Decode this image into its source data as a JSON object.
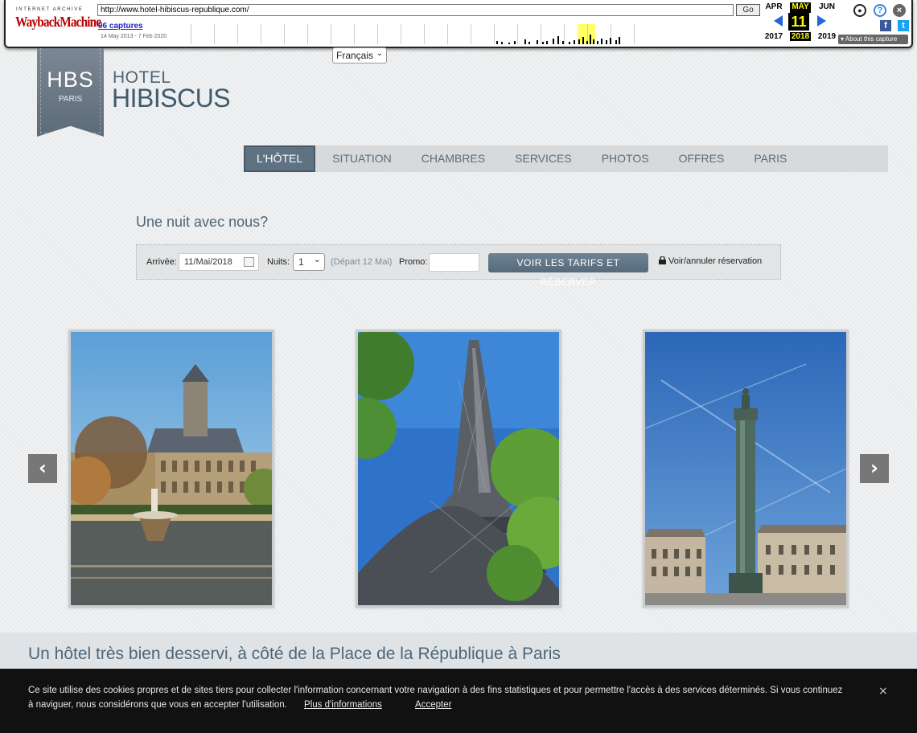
{
  "wayback": {
    "logo_top": "INTERNET ARCHIVE",
    "logo": "WaybackMachine",
    "url": "http://www.hotel-hibiscus-republique.com/",
    "go_label": "Go",
    "captures": "96 captures",
    "range": "14 May 2013 - 7 Feb 2020",
    "months": [
      "APR",
      "MAY",
      "JUN"
    ],
    "day": "11",
    "years": [
      "2017",
      "2018",
      "2019"
    ],
    "about": "About this capture"
  },
  "language": {
    "selected": "Français"
  },
  "brand": {
    "ribbon_main": "HBS",
    "ribbon_sub": "PARIS",
    "line1": "HOTEL",
    "line2": "HIBISCUS"
  },
  "nav": {
    "items": [
      "L'HÔTEL",
      "SITUATION",
      "CHAMBRES",
      "SERVICES",
      "PHOTOS",
      "OFFRES",
      "PARIS"
    ]
  },
  "booking": {
    "title": "Une nuit avec nous?",
    "arrival_label": "Arrivée:",
    "arrival_value": "11/Mai/2018",
    "nights_label": "Nuits:",
    "nights_value": "1",
    "depart": "(Départ 12 Mai)",
    "promo_label": "Promo:",
    "cta": "VOIR LES TARIFS ET RÉSERVER",
    "manage": "Voir/annuler réservation"
  },
  "carousel": {
    "prev": "‹",
    "next": "›"
  },
  "band": {
    "title": "Un hôtel très bien desservi, à côté de la Place de la République à Paris"
  },
  "cookie": {
    "text": "Ce site utilise des cookies propres et de sites tiers pour collecter l'information concernant votre navigation à des fins statistiques et pour permettre l'accès à des services déterminés. Si vous continuez à naviguer, nous considérons que vous en accepter l'utilisation.",
    "more": "Plus d'informations",
    "accept": "Accepter",
    "close": "×"
  }
}
